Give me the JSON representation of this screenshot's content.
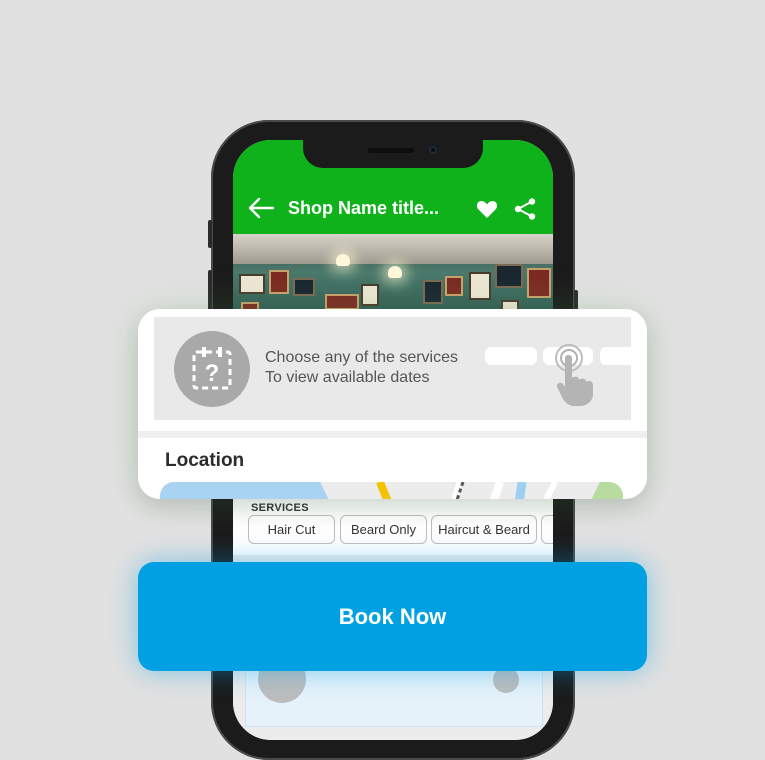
{
  "app": {
    "title": "Shop Name title...",
    "accent_color": "#0fb21a",
    "icons": [
      "back-arrow-icon",
      "heart-icon",
      "share-icon"
    ]
  },
  "services": {
    "label": "SERVICES",
    "chips": [
      {
        "label": "Hair Cut"
      },
      {
        "label": "Beard Only"
      },
      {
        "label": "Haircut & Beard"
      }
    ]
  },
  "calendar_hint": {
    "line1": "Choose any of the services",
    "line2": "To view available dates",
    "icon": "calendar-question-icon",
    "gesture_icon": "tap-hand-icon"
  },
  "location": {
    "heading": "Location"
  },
  "cta": {
    "label": "Book Now",
    "color": "#00a0e3"
  }
}
